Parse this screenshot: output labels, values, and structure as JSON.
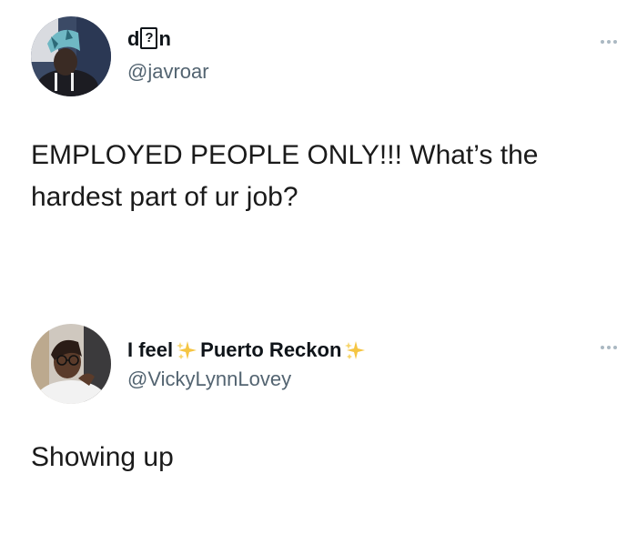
{
  "tweets": [
    {
      "name_prefix": "d",
      "name_glyph": "?",
      "name_suffix": "n",
      "handle": "@javroar",
      "text": "EMPLOYED PEOPLE ONLY!!! What’s the hardest part of ur job?",
      "avatar_icon": "profile-photo"
    },
    {
      "name_part1": "I feel",
      "name_part2": "Puerto Reckon",
      "handle": "@VickyLynnLovey",
      "text": "Showing up",
      "avatar_icon": "profile-photo"
    }
  ],
  "colors": {
    "text": "#0f1419",
    "handle": "#536471",
    "sparkle": "#f5c542",
    "more_dots": "#aab8c2"
  }
}
